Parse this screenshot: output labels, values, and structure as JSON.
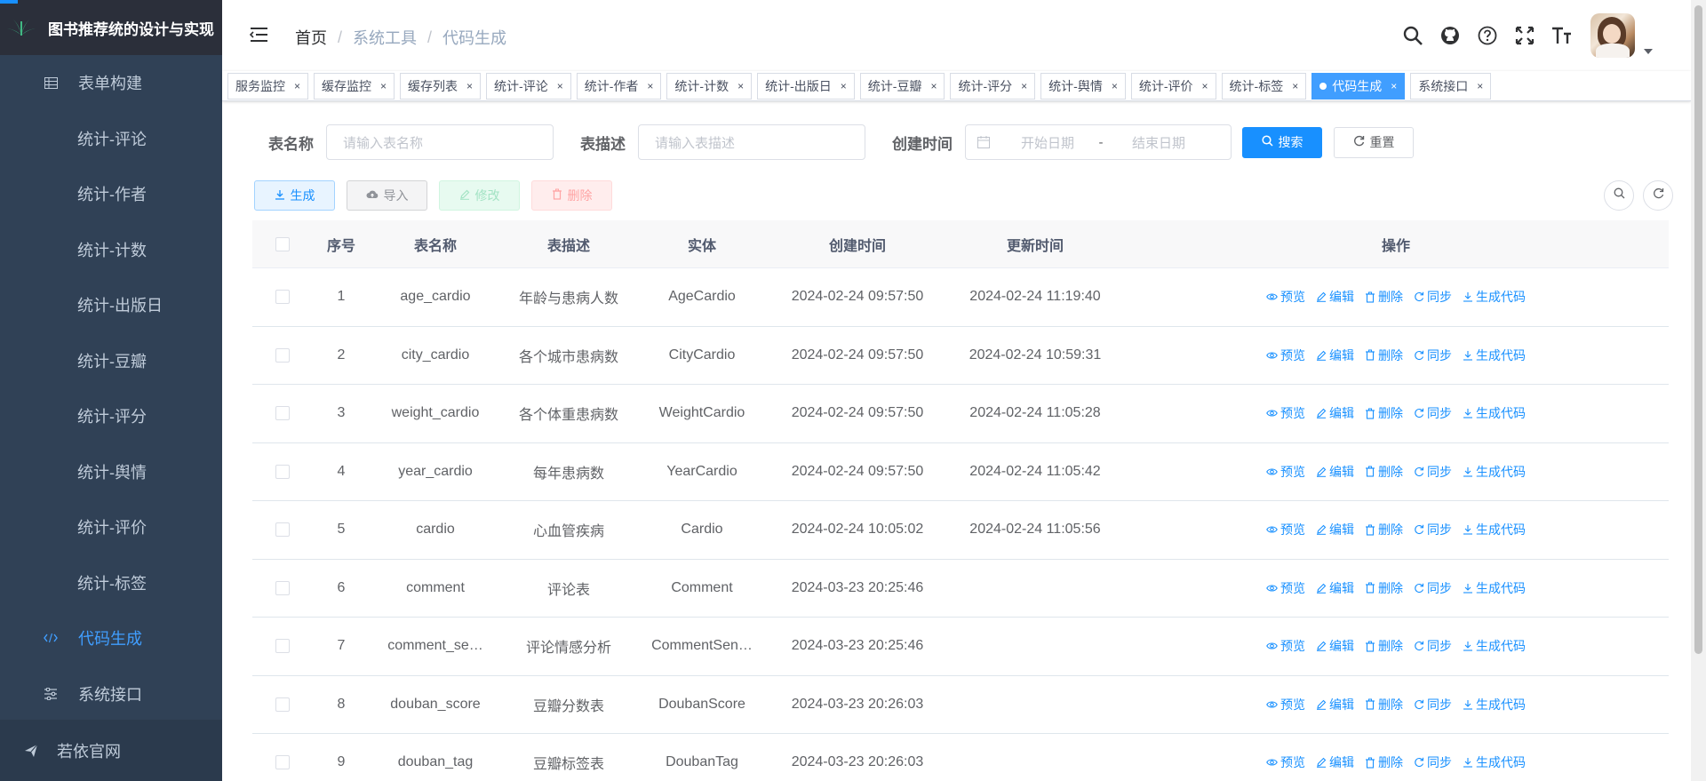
{
  "colors": {
    "sidebar_bg": "#304156",
    "primary": "#1890ff",
    "active_menu": "#409eff"
  },
  "sidebar": {
    "title": "图书推荐统的设计与实现",
    "items": [
      {
        "label": "表单构建",
        "icon": "table-icon"
      },
      {
        "label": "统计-评论"
      },
      {
        "label": "统计-作者"
      },
      {
        "label": "统计-计数"
      },
      {
        "label": "统计-出版日"
      },
      {
        "label": "统计-豆瓣"
      },
      {
        "label": "统计-评分"
      },
      {
        "label": "统计-舆情"
      },
      {
        "label": "统计-评价"
      },
      {
        "label": "统计-标签"
      },
      {
        "label": "代码生成",
        "icon": "code-icon",
        "active": true
      },
      {
        "label": "系统接口",
        "icon": "sliders-icon"
      }
    ],
    "bottom_link": "若依官网"
  },
  "breadcrumb": {
    "home": "首页",
    "sep": "/",
    "level1": "系统工具",
    "level2": "代码生成"
  },
  "tags": [
    {
      "label": "服务监控"
    },
    {
      "label": "缓存监控"
    },
    {
      "label": "缓存列表"
    },
    {
      "label": "统计-评论"
    },
    {
      "label": "统计-作者"
    },
    {
      "label": "统计-计数"
    },
    {
      "label": "统计-出版日"
    },
    {
      "label": "统计-豆瓣"
    },
    {
      "label": "统计-评分"
    },
    {
      "label": "统计-舆情"
    },
    {
      "label": "统计-评价"
    },
    {
      "label": "统计-标签"
    },
    {
      "label": "代码生成",
      "active": true
    },
    {
      "label": "系统接口"
    }
  ],
  "search": {
    "table_name_label": "表名称",
    "table_name_placeholder": "请输入表名称",
    "table_desc_label": "表描述",
    "table_desc_placeholder": "请输入表描述",
    "created_label": "创建时间",
    "start_placeholder": "开始日期",
    "range_sep": "-",
    "end_placeholder": "结束日期",
    "search_btn": "搜索",
    "reset_btn": "重置"
  },
  "toolbar": {
    "generate": "生成",
    "import": "导入",
    "edit": "修改",
    "delete": "删除"
  },
  "table": {
    "headers": {
      "index": "序号",
      "name": "表名称",
      "desc": "表描述",
      "entity": "实体",
      "created": "创建时间",
      "updated": "更新时间",
      "ops": "操作"
    },
    "op_labels": {
      "preview": "预览",
      "edit": "编辑",
      "delete": "删除",
      "sync": "同步",
      "gen": "生成代码"
    },
    "rows": [
      {
        "index": "1",
        "name": "age_cardio",
        "desc": "年龄与患病人数",
        "entity": "AgeCardio",
        "created": "2024-02-24 09:57:50",
        "updated": "2024-02-24 11:19:40"
      },
      {
        "index": "2",
        "name": "city_cardio",
        "desc": "各个城市患病数",
        "entity": "CityCardio",
        "created": "2024-02-24 09:57:50",
        "updated": "2024-02-24 10:59:31"
      },
      {
        "index": "3",
        "name": "weight_cardio",
        "desc": "各个体重患病数",
        "entity": "WeightCardio",
        "created": "2024-02-24 09:57:50",
        "updated": "2024-02-24 11:05:28"
      },
      {
        "index": "4",
        "name": "year_cardio",
        "desc": "每年患病数",
        "entity": "YearCardio",
        "created": "2024-02-24 09:57:50",
        "updated": "2024-02-24 11:05:42"
      },
      {
        "index": "5",
        "name": "cardio",
        "desc": "心血管疾病",
        "entity": "Cardio",
        "created": "2024-02-24 10:05:02",
        "updated": "2024-02-24 11:05:56"
      },
      {
        "index": "6",
        "name": "comment",
        "desc": "评论表",
        "entity": "Comment",
        "created": "2024-03-23 20:25:46",
        "updated": ""
      },
      {
        "index": "7",
        "name": "comment_se…",
        "desc": "评论情感分析",
        "entity": "CommentSen…",
        "created": "2024-03-23 20:25:46",
        "updated": ""
      },
      {
        "index": "8",
        "name": "douban_score",
        "desc": "豆瓣分数表",
        "entity": "DoubanScore",
        "created": "2024-03-23 20:26:03",
        "updated": ""
      },
      {
        "index": "9",
        "name": "douban_tag",
        "desc": "豆瓣标签表",
        "entity": "DoubanTag",
        "created": "2024-03-23 20:26:03",
        "updated": ""
      }
    ]
  }
}
